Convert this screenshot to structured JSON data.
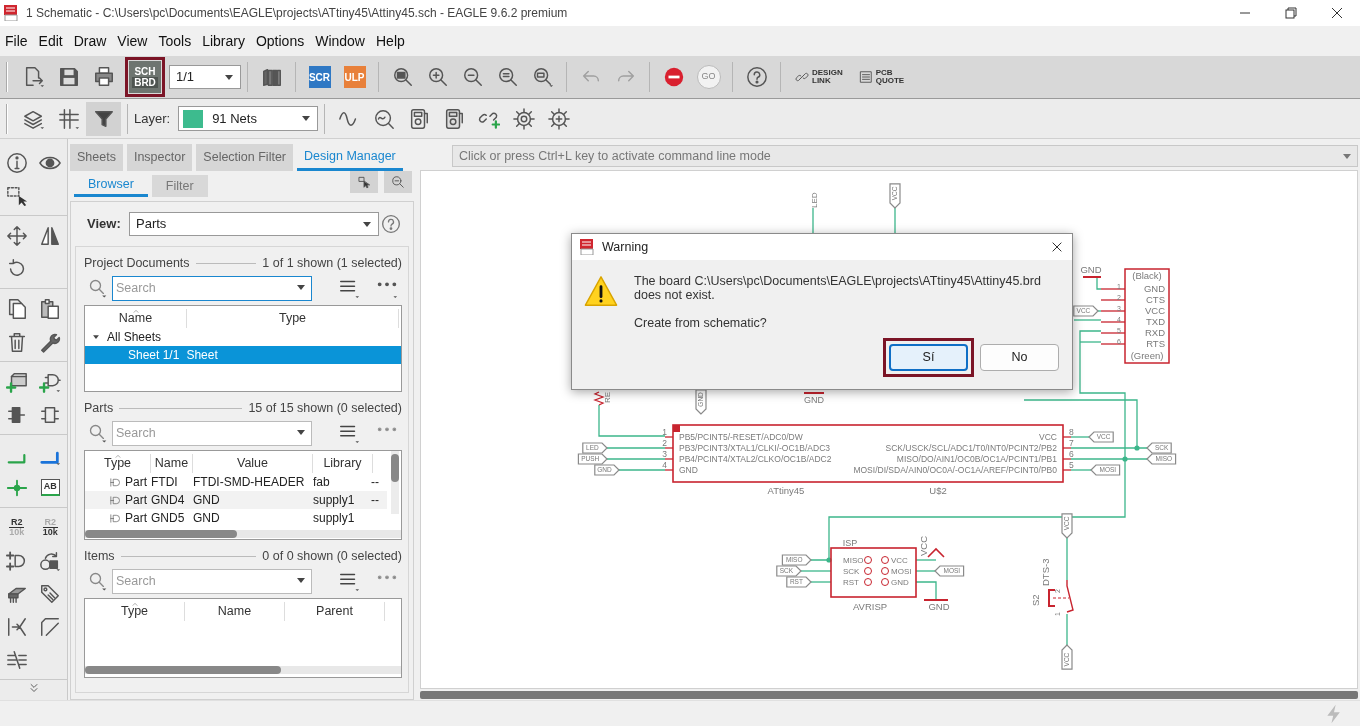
{
  "window": {
    "title": "1 Schematic - C:\\Users\\pc\\Documents\\EAGLE\\projects\\ATtiny45\\Attiny45.sch - EAGLE 9.6.2 premium"
  },
  "menu": [
    "File",
    "Edit",
    "Draw",
    "View",
    "Tools",
    "Library",
    "Options",
    "Window",
    "Help"
  ],
  "toolbar": [
    {
      "kind": "new"
    },
    {
      "kind": "save"
    },
    {
      "kind": "print"
    },
    {
      "kind": "switch",
      "text": "SCH",
      "text_2": "BRD",
      "highlighted": true
    },
    {
      "kind": "sheet",
      "value": "1/1"
    },
    {
      "kind": "separator"
    },
    {
      "kind": "library"
    },
    {
      "kind": "separator"
    },
    {
      "kind": "script",
      "text": "SCR"
    },
    {
      "kind": "ulp",
      "text": "ULP"
    },
    {
      "kind": "separator"
    },
    {
      "kind": "zoom-fit"
    },
    {
      "kind": "zoom-in"
    },
    {
      "kind": "zoom-out"
    },
    {
      "kind": "redraw"
    },
    {
      "kind": "zoom-select"
    },
    {
      "kind": "separator"
    },
    {
      "kind": "undo",
      "disabled": true
    },
    {
      "kind": "redo",
      "disabled": true
    },
    {
      "kind": "separator"
    },
    {
      "kind": "stop",
      "disabled": false
    },
    {
      "kind": "go",
      "text": "GO",
      "disabled": true
    },
    {
      "kind": "separator"
    },
    {
      "kind": "help"
    },
    {
      "kind": "separator"
    },
    {
      "kind": "design-link",
      "text": "DESIGN",
      "text_2": "LINK"
    },
    {
      "kind": "pcb-quote",
      "text": "PCB",
      "text_2": "QUOTE"
    }
  ],
  "toolbar_2": [
    {
      "kind": "layers"
    },
    {
      "kind": "grid"
    },
    {
      "kind": "filter",
      "selected": true
    },
    {
      "kind": "separator"
    },
    {
      "kind": "layer",
      "label": "Layer:",
      "value": "91 Nets",
      "color": "#3dbb8e"
    },
    {
      "kind": "separator"
    },
    {
      "kind": "wave"
    },
    {
      "kind": "probe"
    },
    {
      "kind": "meter"
    },
    {
      "kind": "meter-2"
    },
    {
      "kind": "add-link"
    },
    {
      "kind": "gear"
    },
    {
      "kind": "gear-2"
    }
  ],
  "tool_groups": [
    [
      [
        {
          "kind": "info"
        },
        {
          "kind": "eye"
        }
      ],
      [
        {
          "kind": "select"
        }
      ]
    ],
    [
      [
        {
          "kind": "move"
        },
        {
          "kind": "mirror"
        }
      ],
      [
        {
          "kind": "rotate"
        }
      ]
    ],
    [
      [
        {
          "kind": "copy"
        },
        {
          "kind": "paste"
        }
      ],
      [
        {
          "kind": "delete"
        },
        {
          "kind": "wrench"
        }
      ]
    ],
    [
      [
        {
          "kind": "add-part"
        },
        {
          "kind": "add-gate"
        }
      ],
      [
        {
          "kind": "smash"
        },
        {
          "kind": "split"
        }
      ]
    ],
    [
      [
        {
          "kind": "net"
        },
        {
          "kind": "bus"
        }
      ],
      [
        {
          "kind": "junction"
        },
        {
          "kind": "label",
          "text": "AB"
        }
      ]
    ],
    [
      [
        {
          "kind": "name",
          "text": "R2",
          "text_2": "10k"
        },
        {
          "kind": "value",
          "text": "R2",
          "text_2": "10k"
        }
      ],
      [
        {
          "kind": "invoke"
        },
        {
          "kind": "replace"
        }
      ],
      [
        {
          "kind": "package"
        },
        {
          "kind": "attribute"
        }
      ],
      [
        {
          "kind": "port"
        },
        {
          "kind": "miter"
        }
      ],
      [
        {
          "kind": "erc"
        }
      ]
    ]
  ],
  "panel": {
    "tabs": [
      {
        "label": "Sheets",
        "selected": false
      },
      {
        "label": "Inspector",
        "selected": false
      },
      {
        "label": "Selection Filter",
        "selected": false
      },
      {
        "label": "Design Manager",
        "selected": true
      }
    ],
    "subtabs": [
      {
        "label": "Browser",
        "selected": true
      },
      {
        "label": "Filter",
        "selected": false
      }
    ],
    "view": {
      "label": "View:",
      "value": "Parts"
    },
    "project_documents": {
      "title": "Project Documents",
      "count": "1 of 1 shown (1 selected)",
      "search": {
        "placeholder": "Search"
      },
      "columns": [
        "Name",
        "Type"
      ],
      "tree": [
        {
          "label": "All Sheets",
          "expanded": true,
          "children": [
            {
              "label": "Sheet 1/1",
              "type": "Sheet",
              "selected": true
            }
          ]
        }
      ]
    },
    "parts": {
      "title": "Parts",
      "count": "15 of 15 shown (0 selected)",
      "search": {
        "placeholder": "Search"
      },
      "columns": [
        "Type",
        "Name",
        "Value",
        "Library"
      ],
      "rows": [
        {
          "type": "Part",
          "name": "FTDI",
          "value": "FTDI-SMD-HEADER",
          "library": "fab",
          "column_5": "--"
        },
        {
          "type": "Part",
          "name": "GND4",
          "value": "GND",
          "library": "supply1",
          "column_5": "--"
        },
        {
          "type": "Part",
          "name": "GND5",
          "value": "GND",
          "library": "supply1"
        }
      ]
    },
    "items": {
      "title": "Items",
      "count": "0 of 0 shown (0 selected)",
      "search": {
        "placeholder": "Search"
      },
      "columns": [
        "Type",
        "Name",
        "Parent"
      ]
    }
  },
  "command_line": {
    "placeholder": "Click or press Ctrl+L key to activate command line mode"
  },
  "schematic": {
    "labels": [
      {
        "kind": "text",
        "text": "LED"
      },
      {
        "kind": "tag",
        "text": "VCC"
      },
      {
        "kind": "text",
        "text": "GND"
      },
      {
        "kind": "text",
        "text": "(Black)"
      },
      {
        "kind": "text",
        "text": "1"
      },
      {
        "kind": "text",
        "text": "GND"
      },
      {
        "kind": "text",
        "text": "2"
      },
      {
        "kind": "text",
        "text": "CTS"
      },
      {
        "kind": "text",
        "text": "3"
      },
      {
        "kind": "text",
        "text": "VCC"
      },
      {
        "kind": "text",
        "text": "4"
      },
      {
        "kind": "text",
        "text": "TXD"
      },
      {
        "kind": "text",
        "text": "5"
      },
      {
        "kind": "text",
        "text": "RXD"
      },
      {
        "kind": "text",
        "text": "6"
      },
      {
        "kind": "text",
        "text": "RTS"
      },
      {
        "kind": "text",
        "text": "(Green)"
      },
      {
        "kind": "tag",
        "text": "VCC"
      },
      {
        "kind": "text",
        "text": "RE"
      },
      {
        "kind": "tag",
        "text": "GND"
      },
      {
        "kind": "text",
        "text": "GND"
      },
      {
        "kind": "text",
        "text": "1"
      },
      {
        "kind": "text",
        "text": "PB5/PCINT5/-RESET/ADC0/DW"
      },
      {
        "kind": "text",
        "text": "2"
      },
      {
        "kind": "text",
        "text": "PB3/PCINT3/XTAL1/CLKI/-OC1B/ADC3"
      },
      {
        "kind": "text",
        "text": "3"
      },
      {
        "kind": "text",
        "text": "PB4/PCINT4/XTAL2/CLKO/OC1B/ADC2"
      },
      {
        "kind": "text",
        "text": "4"
      },
      {
        "kind": "text",
        "text": "GND"
      },
      {
        "kind": "text",
        "text": "8"
      },
      {
        "kind": "text",
        "text": "VCC"
      },
      {
        "kind": "text",
        "text": "7"
      },
      {
        "kind": "text",
        "text": "SCK/USCK/SCL/ADC1/T0/INT0/PCINT2/PB2"
      },
      {
        "kind": "text",
        "text": "6"
      },
      {
        "kind": "text",
        "text": "MISO/DO/AIN1/OC0B/OC1A/PCINT1/PB1"
      },
      {
        "kind": "text",
        "text": "5"
      },
      {
        "kind": "text",
        "text": "MOSI/DI/SDA/AIN0/OC0A/-OC1A/AREF/PCINT0/PB0"
      },
      {
        "kind": "text",
        "text": "ATtiny45"
      },
      {
        "kind": "text",
        "text": "U$2"
      },
      {
        "kind": "tag",
        "text": "LED"
      },
      {
        "kind": "tag",
        "text": "PUSH"
      },
      {
        "kind": "tag",
        "text": "GND"
      },
      {
        "kind": "tag",
        "text": "VCC"
      },
      {
        "kind": "tag",
        "text": "SCK"
      },
      {
        "kind": "tag",
        "text": "MISO"
      },
      {
        "kind": "tag",
        "text": "MOSI"
      },
      {
        "kind": "text",
        "text": "ISP"
      },
      {
        "kind": "text",
        "text": "MISO"
      },
      {
        "kind": "text",
        "text": "SCK"
      },
      {
        "kind": "text",
        "text": "RST"
      },
      {
        "kind": "text",
        "text": "VCC"
      },
      {
        "kind": "text",
        "text": "MOSI"
      },
      {
        "kind": "text",
        "text": "GND"
      },
      {
        "kind": "text",
        "text": "AVRISP"
      },
      {
        "kind": "text",
        "text": "VCC"
      },
      {
        "kind": "text",
        "text": "GND"
      },
      {
        "kind": "tag",
        "text": "MISO"
      },
      {
        "kind": "tag",
        "text": "SCK"
      },
      {
        "kind": "tag",
        "text": "RST"
      },
      {
        "kind": "tag",
        "text": "MOSI"
      },
      {
        "kind": "tag",
        "text": "VCC"
      },
      {
        "kind": "text",
        "text": "DTS-3"
      },
      {
        "kind": "text",
        "text": "S2"
      },
      {
        "kind": "text",
        "text": "2"
      },
      {
        "kind": "text",
        "text": "1"
      },
      {
        "kind": "tag",
        "text": "VCC"
      }
    ]
  },
  "dialog": {
    "title": "Warning",
    "message": "The board C:\\Users\\pc\\Documents\\EAGLE\\projects\\ATtiny45\\Attiny45.brd\ndoes not exist.",
    "question": "Create from schematic?",
    "buttons": [
      {
        "label": "Sí",
        "selected": true,
        "highlighted": true
      },
      {
        "label": "No",
        "selected": false,
        "highlighted": false
      }
    ]
  }
}
